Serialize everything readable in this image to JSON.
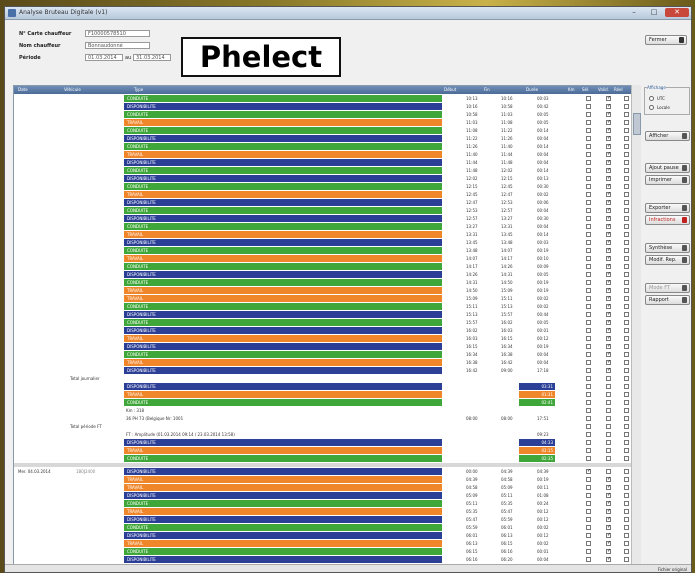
{
  "window": {
    "title": "Analyse Bruteau Digitale (v1)",
    "min": "–",
    "max": "□",
    "close": "✕"
  },
  "header": {
    "card_label": "N° Carte chauffeur",
    "card_value": "F10000578510",
    "name_label": "Nom chauffeur",
    "name_value": "Bonnaudonné",
    "period_label": "Période",
    "period_from": "01.03.2014",
    "period_to_sep": "au",
    "period_to": "31.03.2014",
    "logo": "Phelect",
    "close_button": "Fermer"
  },
  "grid": {
    "columns": [
      "Date",
      "Véhicule",
      "Type",
      "Début",
      "Fin",
      "Durée",
      "Km",
      "Sél.",
      "Valid.",
      "Réel"
    ],
    "rows": [
      {
        "type": "bar",
        "color": "green",
        "label": "CONDUITE",
        "start": "10:13",
        "end": "10:16",
        "dur": "00:03",
        "c": [
          0,
          1,
          0
        ]
      },
      {
        "type": "bar",
        "color": "blue",
        "label": "DISPONIBILITE",
        "start": "10:16",
        "end": "10:58",
        "dur": "00:42",
        "c": [
          0,
          1,
          0
        ]
      },
      {
        "type": "bar",
        "color": "green",
        "label": "CONDUITE",
        "start": "10:58",
        "end": "11:03",
        "dur": "00:05",
        "c": [
          0,
          1,
          0
        ]
      },
      {
        "type": "bar",
        "color": "orange",
        "label": "TRAVAIL",
        "start": "11:03",
        "end": "11:08",
        "dur": "00:05",
        "c": [
          0,
          1,
          0
        ]
      },
      {
        "type": "bar",
        "color": "green",
        "label": "CONDUITE",
        "start": "11:08",
        "end": "11:22",
        "dur": "00:14",
        "c": [
          0,
          1,
          0
        ]
      },
      {
        "type": "bar",
        "color": "blue",
        "label": "DISPONIBILITE",
        "start": "11:22",
        "end": "11:26",
        "dur": "00:04",
        "c": [
          0,
          1,
          0
        ]
      },
      {
        "type": "bar",
        "color": "green",
        "label": "CONDUITE",
        "start": "11:26",
        "end": "11:40",
        "dur": "00:14",
        "c": [
          0,
          1,
          0
        ]
      },
      {
        "type": "bar",
        "color": "orange",
        "label": "TRAVAIL",
        "start": "11:40",
        "end": "11:44",
        "dur": "00:04",
        "c": [
          0,
          1,
          0
        ]
      },
      {
        "type": "bar",
        "color": "blue",
        "label": "DISPONIBILITE",
        "start": "11:44",
        "end": "11:48",
        "dur": "00:04",
        "c": [
          0,
          1,
          0
        ]
      },
      {
        "type": "bar",
        "color": "green",
        "label": "CONDUITE",
        "start": "11:48",
        "end": "12:02",
        "dur": "00:14",
        "c": [
          0,
          1,
          0
        ]
      },
      {
        "type": "bar",
        "color": "blue",
        "label": "DISPONIBILITE",
        "start": "12:02",
        "end": "12:15",
        "dur": "00:13",
        "c": [
          0,
          1,
          0
        ]
      },
      {
        "type": "bar",
        "color": "green",
        "label": "CONDUITE",
        "start": "12:15",
        "end": "12:45",
        "dur": "00:30",
        "c": [
          0,
          1,
          0
        ]
      },
      {
        "type": "bar",
        "color": "orange",
        "label": "TRAVAIL",
        "start": "12:45",
        "end": "12:47",
        "dur": "00:02",
        "c": [
          0,
          1,
          0
        ]
      },
      {
        "type": "bar",
        "color": "blue",
        "label": "DISPONIBILITE",
        "start": "12:47",
        "end": "12:53",
        "dur": "00:06",
        "c": [
          0,
          1,
          0
        ]
      },
      {
        "type": "bar",
        "color": "green",
        "label": "CONDUITE",
        "start": "12:53",
        "end": "12:57",
        "dur": "00:04",
        "c": [
          0,
          1,
          0
        ]
      },
      {
        "type": "bar",
        "color": "blue",
        "label": "DISPONIBILITE",
        "start": "12:57",
        "end": "13:27",
        "dur": "00:30",
        "c": [
          0,
          1,
          0
        ]
      },
      {
        "type": "bar",
        "color": "green",
        "label": "CONDUITE",
        "start": "13:27",
        "end": "13:31",
        "dur": "00:04",
        "c": [
          0,
          1,
          0
        ]
      },
      {
        "type": "bar",
        "color": "orange",
        "label": "TRAVAIL",
        "start": "13:31",
        "end": "13:45",
        "dur": "00:14",
        "c": [
          0,
          1,
          0
        ]
      },
      {
        "type": "bar",
        "color": "blue",
        "label": "DISPONIBILITE",
        "start": "13:45",
        "end": "13:48",
        "dur": "00:03",
        "c": [
          0,
          1,
          0
        ]
      },
      {
        "type": "bar",
        "color": "green",
        "label": "CONDUITE",
        "start": "13:48",
        "end": "14:07",
        "dur": "00:19",
        "c": [
          0,
          1,
          0
        ]
      },
      {
        "type": "bar",
        "color": "orange",
        "label": "TRAVAIL",
        "start": "14:07",
        "end": "14:17",
        "dur": "00:10",
        "c": [
          0,
          1,
          0
        ]
      },
      {
        "type": "bar",
        "color": "green",
        "label": "CONDUITE",
        "start": "14:17",
        "end": "14:26",
        "dur": "00:09",
        "c": [
          0,
          1,
          0
        ]
      },
      {
        "type": "bar",
        "color": "blue",
        "label": "DISPONIBILITE",
        "start": "14:26",
        "end": "14:31",
        "dur": "00:05",
        "c": [
          0,
          1,
          0
        ]
      },
      {
        "type": "bar",
        "color": "green",
        "label": "CONDUITE",
        "start": "14:31",
        "end": "14:50",
        "dur": "00:19",
        "c": [
          0,
          1,
          0
        ]
      },
      {
        "type": "bar",
        "color": "orange",
        "label": "TRAVAIL",
        "start": "14:50",
        "end": "15:09",
        "dur": "00:19",
        "c": [
          0,
          1,
          0
        ]
      },
      {
        "type": "bar",
        "color": "orange",
        "label": "TRAVAIL",
        "start": "15:09",
        "end": "15:11",
        "dur": "00:02",
        "c": [
          0,
          1,
          0
        ]
      },
      {
        "type": "bar",
        "color": "green",
        "label": "CONDUITE",
        "start": "15:11",
        "end": "15:13",
        "dur": "00:02",
        "c": [
          0,
          1,
          0
        ]
      },
      {
        "type": "bar",
        "color": "blue",
        "label": "DISPONIBILITE",
        "start": "15:13",
        "end": "15:57",
        "dur": "00:44",
        "c": [
          0,
          1,
          0
        ]
      },
      {
        "type": "bar",
        "color": "green",
        "label": "CONDUITE",
        "start": "15:57",
        "end": "16:02",
        "dur": "00:05",
        "c": [
          0,
          1,
          0
        ]
      },
      {
        "type": "bar",
        "color": "blue",
        "label": "DISPONIBILITE",
        "start": "16:02",
        "end": "16:03",
        "dur": "00:01",
        "c": [
          0,
          1,
          0
        ]
      },
      {
        "type": "bar",
        "color": "orange",
        "label": "TRAVAIL",
        "start": "16:03",
        "end": "16:15",
        "dur": "00:12",
        "c": [
          0,
          1,
          0
        ]
      },
      {
        "type": "bar",
        "color": "blue",
        "label": "DISPONIBILITE",
        "start": "16:15",
        "end": "16:34",
        "dur": "00:19",
        "c": [
          0,
          1,
          0
        ]
      },
      {
        "type": "bar",
        "color": "green",
        "label": "CONDUITE",
        "start": "16:34",
        "end": "16:38",
        "dur": "00:04",
        "c": [
          0,
          1,
          0
        ]
      },
      {
        "type": "bar",
        "color": "orange",
        "label": "TRAVAIL",
        "start": "16:38",
        "end": "16:42",
        "dur": "00:04",
        "c": [
          0,
          1,
          0
        ]
      },
      {
        "type": "bar",
        "color": "blue",
        "label": "DISPONIBILITE",
        "start": "16:42",
        "end": "09:00",
        "dur": "17:18",
        "c": [
          0,
          1,
          0
        ]
      },
      {
        "type": "text",
        "left": "Total journalier",
        "c": [
          0,
          0,
          0
        ]
      },
      {
        "type": "sum",
        "color": "blue",
        "label": "DISPONIBILITE",
        "dur": "03:31",
        "c": [
          0,
          0,
          0
        ]
      },
      {
        "type": "sum",
        "color": "orange",
        "label": "TRAVAIL",
        "dur": "01:31",
        "c": [
          0,
          0,
          0
        ]
      },
      {
        "type": "sum",
        "color": "green",
        "label": "CONDUITE",
        "dur": "02:41",
        "c": [
          0,
          0,
          0
        ]
      },
      {
        "type": "info",
        "text": "Km :  318",
        "c": [
          0,
          0,
          0
        ]
      },
      {
        "type": "info",
        "text": "36 PH 73 (Belgique Nr: 1001",
        "start": "08:00",
        "end": "08:00",
        "dur": "17:51",
        "c": [
          0,
          0,
          0
        ]
      },
      {
        "type": "text",
        "left": "Total période FT",
        "c": [
          0,
          0,
          0
        ]
      },
      {
        "type": "info",
        "text": "FT : Amplitude (01.03.2014 09:14 / 23.03.2014 13:58)",
        "dur": "09:23",
        "c": [
          0,
          0,
          0
        ]
      },
      {
        "type": "sum",
        "color": "blue",
        "label": "DISPONIBILITE",
        "dur": "04:33",
        "c": [
          0,
          0,
          0
        ]
      },
      {
        "type": "sum",
        "color": "orange",
        "label": "TRAVAIL",
        "dur": "02:15",
        "c": [
          0,
          0,
          0
        ]
      },
      {
        "type": "sum",
        "color": "green",
        "label": "CONDUITE",
        "dur": "02:35",
        "c": [
          0,
          0,
          0
        ]
      },
      {
        "type": "gap",
        "c": [
          0,
          0,
          0
        ]
      },
      {
        "type": "bar",
        "color": "blue",
        "label": "DISPONIBILITE",
        "date": "Mer. 04.03.2014",
        "veh": "1B0J2400",
        "start": "00:00",
        "end": "04:39",
        "dur": "04:39",
        "c": [
          1,
          0,
          0
        ]
      },
      {
        "type": "bar",
        "color": "orange",
        "label": "TRAVAIL",
        "start": "04:39",
        "end": "04:58",
        "dur": "00:19",
        "c": [
          0,
          1,
          0
        ]
      },
      {
        "type": "bar",
        "color": "orange",
        "label": "TRAVAIL",
        "start": "04:58",
        "end": "05:09",
        "dur": "00:11",
        "c": [
          0,
          1,
          0
        ]
      },
      {
        "type": "bar",
        "color": "blue",
        "label": "DISPONIBILITE",
        "start": "05:09",
        "end": "05:11",
        "dur": "01:08",
        "c": [
          0,
          1,
          0
        ]
      },
      {
        "type": "bar",
        "color": "green",
        "label": "CONDUITE",
        "start": "05:11",
        "end": "05:35",
        "dur": "00:24",
        "c": [
          0,
          1,
          0
        ]
      },
      {
        "type": "bar",
        "color": "orange",
        "label": "TRAVAIL",
        "start": "05:35",
        "end": "05:47",
        "dur": "00:12",
        "c": [
          0,
          1,
          0
        ]
      },
      {
        "type": "bar",
        "color": "blue",
        "label": "DISPONIBILITE",
        "start": "05:47",
        "end": "05:59",
        "dur": "00:12",
        "c": [
          0,
          1,
          0
        ]
      },
      {
        "type": "bar",
        "color": "green",
        "label": "CONDUITE",
        "start": "05:59",
        "end": "06:01",
        "dur": "00:02",
        "c": [
          0,
          1,
          0
        ]
      },
      {
        "type": "bar",
        "color": "blue",
        "label": "DISPONIBILITE",
        "start": "06:01",
        "end": "06:13",
        "dur": "00:12",
        "c": [
          0,
          1,
          0
        ]
      },
      {
        "type": "bar",
        "color": "orange",
        "label": "TRAVAIL",
        "start": "06:13",
        "end": "06:15",
        "dur": "00:02",
        "c": [
          0,
          1,
          0
        ]
      },
      {
        "type": "bar",
        "color": "green",
        "label": "CONDUITE",
        "start": "06:15",
        "end": "06:16",
        "dur": "00:01",
        "c": [
          0,
          1,
          0
        ]
      },
      {
        "type": "bar",
        "color": "blue",
        "label": "DISPONIBILITE",
        "start": "06:16",
        "end": "06:20",
        "dur": "00:04",
        "c": [
          0,
          1,
          0
        ]
      },
      {
        "type": "bar",
        "color": "orange",
        "label": "TRAVAIL",
        "start": "06:20",
        "end": "06:21",
        "dur": "00:01",
        "c": [
          0,
          1,
          0
        ]
      },
      {
        "type": "bar",
        "color": "green",
        "label": "CONDUITE",
        "start": "06:21",
        "end": "06:27",
        "dur": "00:06",
        "c": [
          0,
          1,
          0
        ]
      },
      {
        "type": "bar",
        "color": "orange",
        "label": "TRAVAIL",
        "start": "06:27",
        "end": "06:30",
        "dur": "00:03",
        "c": [
          0,
          1,
          0
        ]
      },
      {
        "type": "bar",
        "color": "blue",
        "label": "DISPONIBILITE",
        "start": "06:30",
        "end": "06:31",
        "dur": "00:01",
        "c": [
          0,
          1,
          0
        ]
      }
    ]
  },
  "side": {
    "group_title": "Affichage",
    "radio_utc": "UTC",
    "radio_local": "Locale",
    "buttons": [
      {
        "label": "Afficher",
        "icon": "arrow-right-icon",
        "pos": "a"
      },
      {
        "label": "Ajout pause",
        "icon": "plus-icon",
        "pos": "b"
      },
      {
        "label": "Imprimer",
        "icon": "printer-icon",
        "pos": "c"
      },
      {
        "label": "Exporter",
        "icon": "export-icon",
        "pos": "d"
      },
      {
        "label": "Infractions",
        "icon": "warning-icon",
        "pos": "e",
        "red": true
      },
      {
        "label": "Synthèse",
        "icon": "chart-icon",
        "pos": "f"
      },
      {
        "label": "Modif. Rep.",
        "icon": "edit-icon",
        "pos": "g"
      },
      {
        "label": "Mode FT",
        "icon": "pen-icon",
        "pos": "h",
        "disabled": true
      },
      {
        "label": "Rapport",
        "icon": "report-icon",
        "pos": "i"
      }
    ]
  },
  "status": {
    "text": "Fichier original"
  },
  "colors": {
    "green": "#3fa73a",
    "blue": "#2b3f96",
    "orange": "#f0862a",
    "header": "#4c6c98"
  }
}
